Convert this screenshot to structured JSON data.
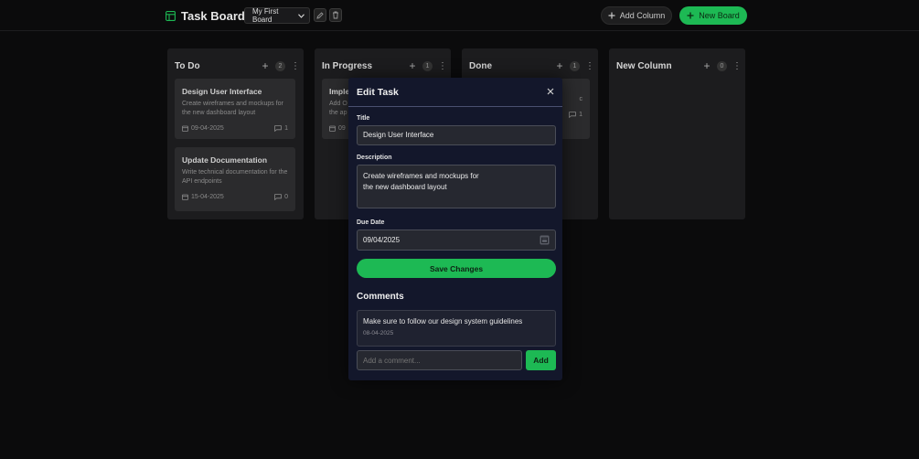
{
  "header": {
    "app_title": "Task Board",
    "board_select_value": "My First Board",
    "add_column_label": "Add Column",
    "new_board_label": "New Board",
    "accent": "#1db954"
  },
  "columns": [
    {
      "title": "To Do",
      "count": "2",
      "cards": [
        {
          "title": "Design User Interface",
          "desc": "Create wireframes and mockups for the new dashboard layout",
          "date": "09-04-2025",
          "comments": "1"
        },
        {
          "title": "Update Documentation",
          "desc": "Write technical documentation for the API endpoints",
          "date": "15-04-2025",
          "comments": "0"
        }
      ]
    },
    {
      "title": "In Progress",
      "count": "1",
      "cards": [
        {
          "title": "Imple",
          "desc": "Add O the ap",
          "date": "09",
          "comments": ""
        }
      ]
    },
    {
      "title": "Done",
      "count": "1",
      "cards": [
        {
          "title": "",
          "desc": "c",
          "date": "",
          "comments": "1"
        }
      ]
    },
    {
      "title": "New Column",
      "count": "0",
      "cards": []
    }
  ],
  "modal": {
    "title": "Edit Task",
    "title_label": "Title",
    "title_value": "Design User Interface",
    "description_label": "Description",
    "description_value": "Create wireframes and mockups for the new dashboard layout",
    "due_date_label": "Due Date",
    "due_date_value": "09/04/2025",
    "save_label": "Save Changes",
    "comments_heading": "Comments",
    "comments": [
      {
        "text": "Make sure to follow our design system guidelines",
        "date": "08-04-2025"
      }
    ],
    "comment_placeholder": "Add a comment...",
    "add_label": "Add"
  }
}
